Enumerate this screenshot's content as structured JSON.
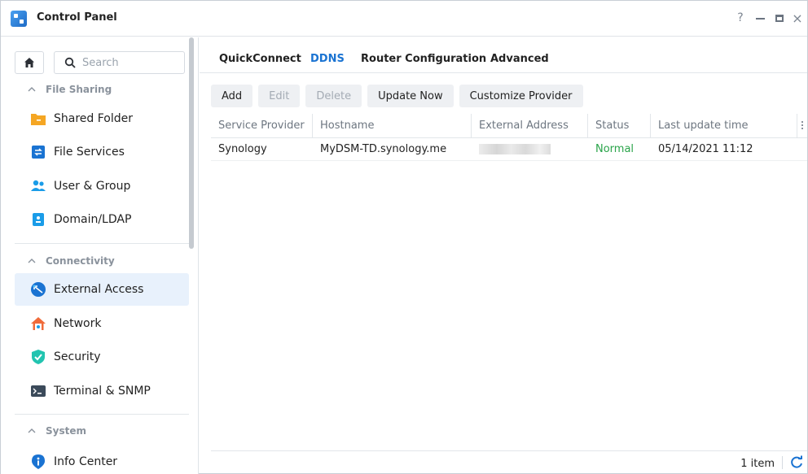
{
  "window": {
    "title": "Control Panel",
    "controls": {
      "help": "?",
      "close": "×"
    }
  },
  "sidebar": {
    "search": {
      "placeholder": "Search",
      "value": ""
    },
    "sections": [
      {
        "label": "File Sharing",
        "items": [
          {
            "label": "Shared Folder",
            "icon": "folder-icon"
          },
          {
            "label": "File Services",
            "icon": "file-services-icon"
          },
          {
            "label": "User & Group",
            "icon": "user-group-icon"
          },
          {
            "label": "Domain/LDAP",
            "icon": "domain-ldap-icon"
          }
        ]
      },
      {
        "label": "Connectivity",
        "items": [
          {
            "label": "External Access",
            "icon": "external-access-icon",
            "active": true
          },
          {
            "label": "Network",
            "icon": "network-icon"
          },
          {
            "label": "Security",
            "icon": "security-shield-icon"
          },
          {
            "label": "Terminal & SNMP",
            "icon": "terminal-icon"
          }
        ]
      },
      {
        "label": "System",
        "items": [
          {
            "label": "Info Center",
            "icon": "info-icon"
          }
        ]
      }
    ]
  },
  "main": {
    "tabs": [
      {
        "label": "QuickConnect",
        "active": false
      },
      {
        "label": "DDNS",
        "active": true
      },
      {
        "label": "Router Configuration",
        "active": false
      },
      {
        "label": "Advanced",
        "active": false
      }
    ],
    "toolbar": {
      "add": "Add",
      "edit": "Edit",
      "delete": "Delete",
      "update_now": "Update Now",
      "customize_provider": "Customize Provider"
    },
    "table": {
      "columns": [
        "Service Provider",
        "Hostname",
        "External Address",
        "Status",
        "Last update time"
      ],
      "rows": [
        {
          "provider": "Synology",
          "hostname": "MyDSM-TD.synology.me",
          "external_address": "",
          "status": "Normal",
          "last_update": "05/14/2021 11:12"
        }
      ]
    },
    "footer": {
      "count": "1 item"
    }
  },
  "colors": {
    "accent": "#1a73d2",
    "active_bg": "#e8f1fc",
    "status_normal": "#2aa44a"
  }
}
